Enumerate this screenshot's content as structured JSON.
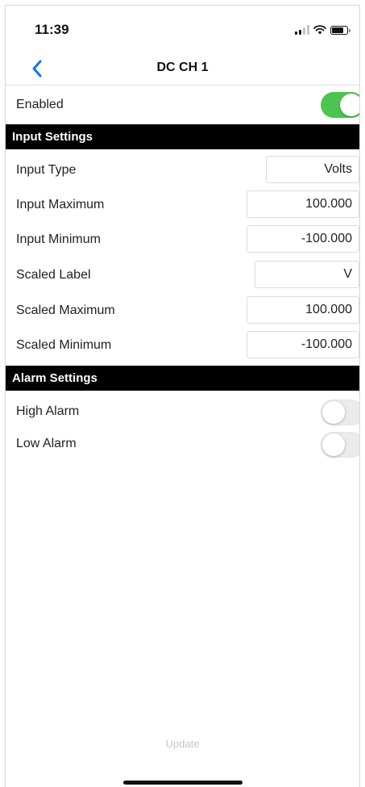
{
  "status_bar": {
    "time": "11:39",
    "icons": [
      "signal-icon",
      "wifi-icon",
      "battery-icon"
    ]
  },
  "nav": {
    "title": "DC CH 1",
    "back_icon": "chevron-left-icon",
    "accent_color": "#1a73e8"
  },
  "enabled": {
    "label": "Enabled",
    "on": true,
    "toggle_color": "#4bc452"
  },
  "input_settings": {
    "title": "Input Settings",
    "rows": [
      {
        "label": "Input Type",
        "value": "Volts"
      },
      {
        "label": "Input Maximum",
        "value": "100.000"
      },
      {
        "label": "Input Minimum",
        "value": "-100.000"
      },
      {
        "label": "Scaled Label",
        "value": "V"
      },
      {
        "label": "Scaled Maximum",
        "value": "100.000"
      },
      {
        "label": "Scaled Minimum",
        "value": "-100.000"
      }
    ]
  },
  "alarm_settings": {
    "title": "Alarm Settings",
    "high_alarm": {
      "label": "High Alarm",
      "on": false
    },
    "low_alarm": {
      "label": "Low Alarm",
      "on": false
    }
  },
  "footer": {
    "update_label": "Update"
  }
}
